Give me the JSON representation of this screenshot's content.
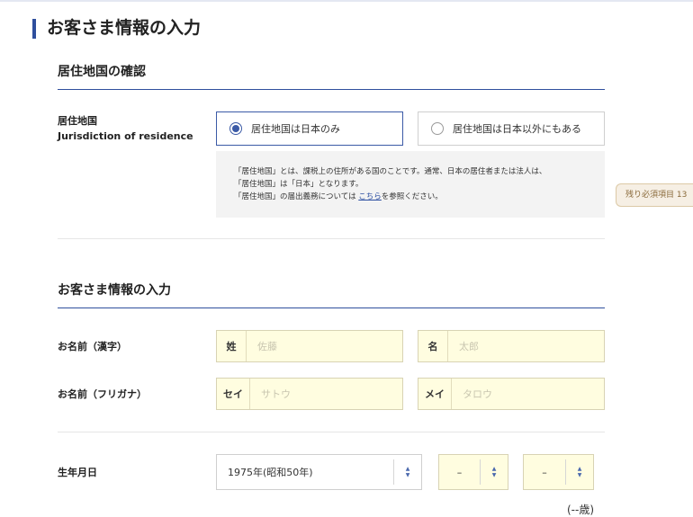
{
  "page": {
    "title": "お客さま情報の入力"
  },
  "residence": {
    "section_title": "居住地国の確認",
    "label_ja": "居住地国",
    "label_en": "Jurisdiction of residence",
    "options": [
      {
        "label": "居住地国は日本のみ",
        "selected": true
      },
      {
        "label": "居住地国は日本以外にもある",
        "selected": false
      }
    ],
    "note": {
      "line1": "「居住地国」とは、課税上の住所がある国のことです。通常、日本の居住者または法人は、",
      "line2": "「居住地国」は「日本」となります。",
      "line3_before": "「居住地国」の届出義務については",
      "line3_link": "こちら",
      "line3_after": "を参照ください。"
    }
  },
  "side_tab": {
    "label": "残り必須項目 13"
  },
  "customer": {
    "section_title": "お客さま情報の入力",
    "name_kanji": {
      "label": "お名前（漢字）",
      "last_prefix": "姓",
      "last_placeholder": "佐藤",
      "last_value": "",
      "first_prefix": "名",
      "first_placeholder": "太郎",
      "first_value": ""
    },
    "name_kana": {
      "label": "お名前（フリガナ）",
      "last_prefix": "セイ",
      "last_placeholder": "サトウ",
      "last_value": "",
      "first_prefix": "メイ",
      "first_placeholder": "タロウ",
      "first_value": ""
    },
    "birthdate": {
      "label": "生年月日",
      "year_value": "1975年(昭和50年)",
      "month_value": "–",
      "day_value": "–",
      "age": "(--歳)"
    }
  },
  "colors": {
    "accent": "#2f4f9d",
    "input_bg": "#fffde0",
    "note_bg": "#f3f3f3"
  }
}
